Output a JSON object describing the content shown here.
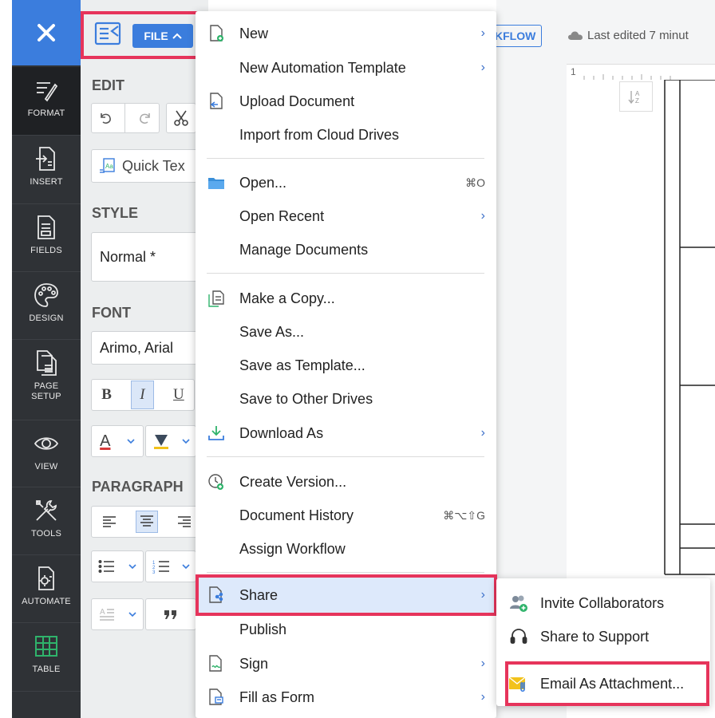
{
  "toolbar": {
    "file_label": "FILE"
  },
  "sidebar": {
    "items": [
      {
        "label": "FORMAT",
        "icon": "format-icon"
      },
      {
        "label": "INSERT",
        "icon": "insert-icon"
      },
      {
        "label": "FIELDS",
        "icon": "fields-icon"
      },
      {
        "label": "DESIGN",
        "icon": "design-icon"
      },
      {
        "label": "PAGE SETUP",
        "icon": "page-setup-icon"
      },
      {
        "label": "VIEW",
        "icon": "view-icon"
      },
      {
        "label": "TOOLS",
        "icon": "tools-icon"
      },
      {
        "label": "AUTOMATE",
        "icon": "automate-icon"
      },
      {
        "label": "TABLE",
        "icon": "table-icon"
      }
    ]
  },
  "panel": {
    "edit_title": "EDIT",
    "quick_text": "Quick Tex",
    "style_title": "STYLE",
    "style_value": "Normal *",
    "font_title": "FONT",
    "font_value": "Arimo, Arial",
    "paragraph_title": "PARAGRAPH",
    "bold": "B",
    "italic": "I",
    "underline": "U",
    "font_color": "A"
  },
  "header": {
    "workflow_label": "KFLOW",
    "last_edited": "Last edited 7 minut",
    "ruler_mark": "1"
  },
  "file_menu": {
    "items": [
      {
        "label": "New",
        "icon": "new-doc-icon",
        "arrow": "›"
      },
      {
        "label": "New Automation Template",
        "arrow": "›"
      },
      {
        "label": "Upload Document",
        "icon": "upload-icon"
      },
      {
        "label": "Import from Cloud Drives"
      },
      {
        "label": "Open...",
        "icon": "folder-icon",
        "shortcut": "⌘O"
      },
      {
        "label": "Open Recent",
        "arrow": "›"
      },
      {
        "label": "Manage Documents"
      },
      {
        "label": "Make a Copy...",
        "icon": "copy-icon"
      },
      {
        "label": "Save As..."
      },
      {
        "label": "Save as Template..."
      },
      {
        "label": "Save to Other Drives"
      },
      {
        "label": "Download As",
        "icon": "download-icon",
        "arrow": "›"
      },
      {
        "label": "Create Version...",
        "icon": "version-icon"
      },
      {
        "label": "Document History",
        "shortcut": "⌘⌥⇧G"
      },
      {
        "label": "Assign Workflow"
      },
      {
        "label": "Share",
        "icon": "share-icon",
        "arrow": "›"
      },
      {
        "label": "Publish"
      },
      {
        "label": "Sign",
        "icon": "sign-icon",
        "arrow": "›"
      },
      {
        "label": "Fill as Form",
        "icon": "form-icon",
        "arrow": "›"
      }
    ]
  },
  "share_submenu": {
    "items": [
      {
        "label": "Invite Collaborators",
        "icon": "collaborators-icon"
      },
      {
        "label": "Share to Support",
        "icon": "headset-icon"
      },
      {
        "label": "Email As Attachment...",
        "icon": "email-attachment-icon"
      }
    ]
  },
  "colors": {
    "accent": "#3b7ddd",
    "highlight_border": "#e6345b",
    "sidebar_bg": "#2f3236",
    "menu_highlight": "#dde9fb"
  }
}
